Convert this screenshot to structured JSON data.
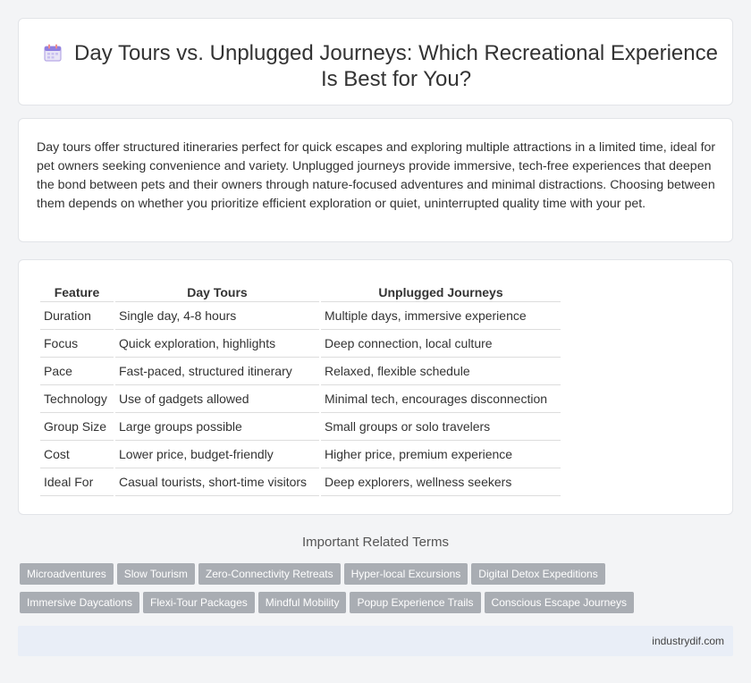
{
  "header": {
    "title": "Day Tours vs. Unplugged Journeys: Which Recreational Experience Is Best for You?",
    "icon": "calendar-icon"
  },
  "summary": "Day tours offer structured itineraries perfect for quick escapes and exploring multiple attractions in a limited time, ideal for pet owners seeking convenience and variety. Unplugged journeys provide immersive, tech-free experiences that deepen the bond between pets and their owners through nature-focused adventures and minimal distractions. Choosing between them depends on whether you prioritize efficient exploration or quiet, uninterrupted quality time with your pet.",
  "table": {
    "headers": [
      "Feature",
      "Day Tours",
      "Unplugged Journeys"
    ],
    "rows": [
      [
        "Duration",
        "Single day, 4-8 hours",
        "Multiple days, immersive experience"
      ],
      [
        "Focus",
        "Quick exploration, highlights",
        "Deep connection, local culture"
      ],
      [
        "Pace",
        "Fast-paced, structured itinerary",
        "Relaxed, flexible schedule"
      ],
      [
        "Technology",
        "Use of gadgets allowed",
        "Minimal tech, encourages disconnection"
      ],
      [
        "Group Size",
        "Large groups possible",
        "Small groups or solo travelers"
      ],
      [
        "Cost",
        "Lower price, budget-friendly",
        "Higher price, premium experience"
      ],
      [
        "Ideal For",
        "Casual tourists, short-time visitors",
        "Deep explorers, wellness seekers"
      ]
    ]
  },
  "related": {
    "title": "Important Related Terms",
    "row1": [
      "Microadventures",
      "Slow Tourism",
      "Zero-Connectivity Retreats",
      "Hyper-local Excursions",
      "Digital Detox Expeditions"
    ],
    "row2": [
      "Immersive Daycations",
      "Flexi-Tour Packages",
      "Mindful Mobility",
      "Popup Experience Trails",
      "Conscious Escape Journeys"
    ]
  },
  "footer": {
    "site": "industrydif.com"
  },
  "colors": {
    "tag_bg": "#a9adb3",
    "footer_bg": "#e9eef7",
    "page_bg": "#f3f4f6"
  }
}
